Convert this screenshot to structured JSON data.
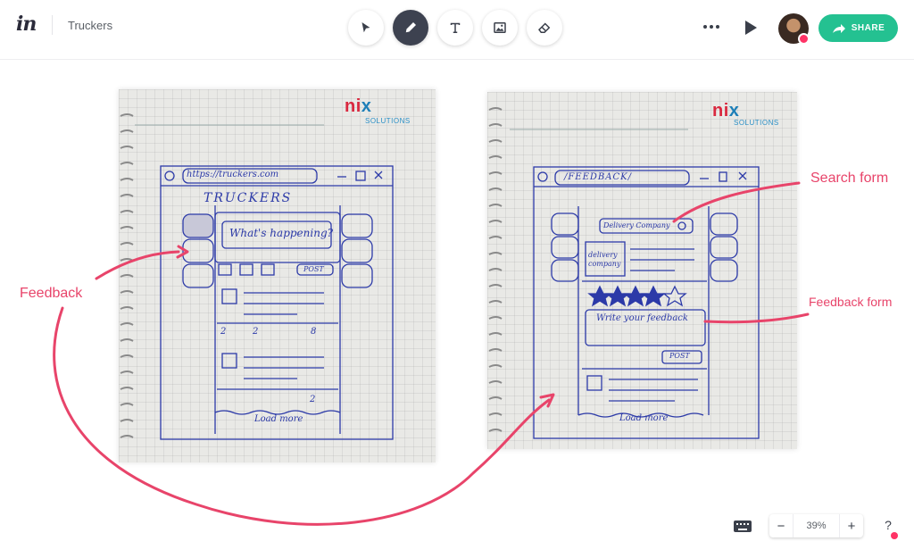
{
  "header": {
    "logo": "in",
    "project_title": "Truckers",
    "share_label": "SHARE"
  },
  "tools": [
    {
      "icon": "cursor-icon",
      "active": false
    },
    {
      "icon": "pen-icon",
      "active": true
    },
    {
      "icon": "text-icon",
      "active": false
    },
    {
      "icon": "image-icon",
      "active": false
    },
    {
      "icon": "eraser-icon",
      "active": false
    }
  ],
  "sketch_left": {
    "brand": "nix",
    "brand_sub": "SOLUTIONS",
    "url": "https://truckers.com",
    "app_title": "TRUCKERS",
    "prompt": "What's happening?",
    "post": "POST",
    "counts": [
      "2",
      "2",
      "8"
    ],
    "like_count": "2",
    "load_more": "Load more"
  },
  "sketch_right": {
    "brand": "nix",
    "brand_sub": "SOLUTIONS",
    "url": "/FEEDBACK/",
    "search_text": "Delivery Company",
    "company_label": "delivery company",
    "feedback_placeholder": "Write your feedback",
    "post": "POST",
    "load_more": "Load more"
  },
  "annotations": {
    "feedback": "Feedback",
    "search_form": "Search form",
    "feedback_form": "Feedback form"
  },
  "footer": {
    "zoom_minus": "−",
    "zoom_value": "39%",
    "zoom_plus": "+",
    "help": "?"
  },
  "colors": {
    "accent": "#24c191",
    "annotation": "#e8446a",
    "active_tool": "#3d4250",
    "ink": "#2c3aa8"
  }
}
